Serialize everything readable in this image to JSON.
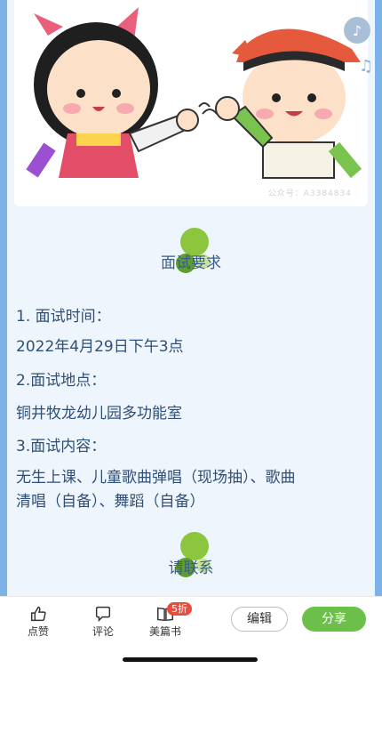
{
  "music": {
    "icon": "music-note-icon"
  },
  "hero": {
    "watermark": "公众号：A3384834"
  },
  "sections": {
    "requirements_title": "面试要求",
    "contact_title": "请联系"
  },
  "content": {
    "line1": "1. 面试时间：",
    "line2": "2022年4月29日下午3点",
    "line3": "2.面试地点：",
    "line4": "铜井牧龙幼儿园多功能室",
    "line5": "3.面试内容：",
    "line6a": "无生上课、儿童歌曲弹唱（现场抽）、歌曲",
    "line6b": "清唱（自备）、舞蹈（自备）"
  },
  "bottom_bar": {
    "like": "点赞",
    "comment": "评论",
    "meipian": "美篇书",
    "meipian_badge": "5折",
    "edit": "编辑",
    "share": "分享"
  },
  "colors": {
    "frame": "#7db2e8",
    "panel": "#eef5fc",
    "text": "#2f4f76",
    "share": "#6cc04a",
    "badge": "#e94b3c"
  }
}
